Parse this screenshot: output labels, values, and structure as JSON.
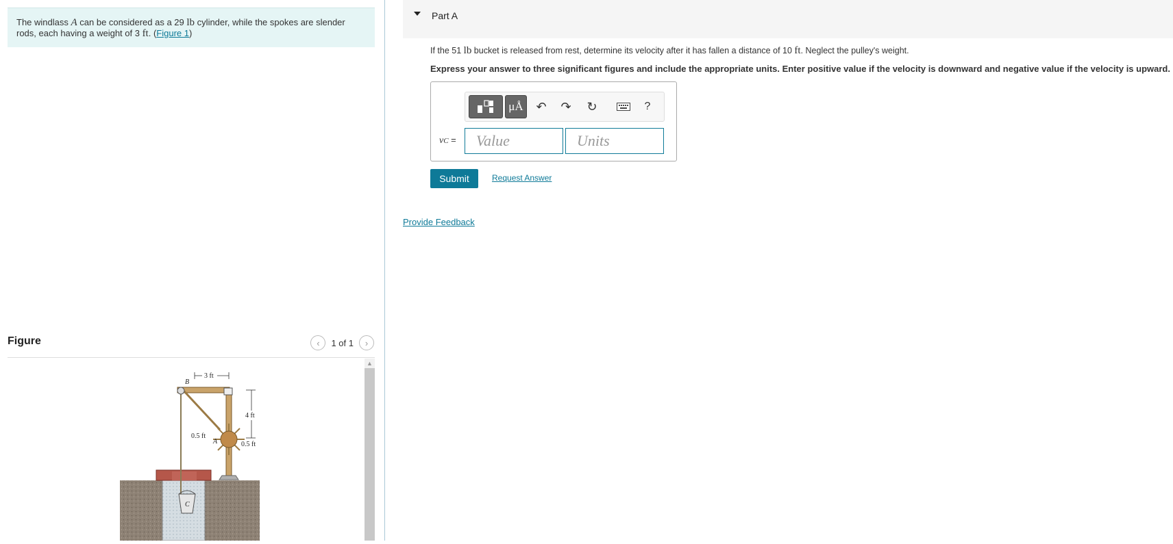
{
  "problem": {
    "text_1": "The windlass ",
    "var_a": "A",
    "text_2": " can be considered as a 29 ",
    "unit_lb": "lb",
    "text_3": " cylinder, while the spokes are slender rods, each having a weight of 3 ",
    "unit_ft": "ft",
    "text_4": ". (",
    "figure_link": "Figure 1",
    "text_5": ")"
  },
  "figure": {
    "label": "Figure",
    "pager": "1 of 1",
    "prev_icon": "chevron-left-icon",
    "next_icon": "chevron-right-icon",
    "labels": {
      "dim_3ft": "3 ft",
      "b": "B",
      "dim_4ft": "4 ft",
      "dim_05ft_left": "0.5 ft",
      "a": "A",
      "dim_05ft_right": "0.5 ft",
      "c": "C"
    }
  },
  "part": {
    "title": "Part A",
    "q_1": "If the 51 ",
    "q_unit_lb": "lb",
    "q_2": " bucket is released from rest, determine its velocity after it has fallen a distance of 10 ",
    "q_unit_ft": "ft",
    "q_3": ". Neglect the pulley's weight.",
    "instructions": "Express your answer to three significant figures and include the appropriate units. Enter positive value if the velocity is downward and negative value if the velocity is upward."
  },
  "answer": {
    "var": "v",
    "var_sub": "C",
    "equals": " =",
    "value_placeholder": "Value",
    "units_placeholder": "Units",
    "toolbar": {
      "templates_icon": "templates-icon",
      "units_symbol": "μÅ",
      "undo_icon": "undo-icon",
      "redo_icon": "redo-icon",
      "reset_icon": "reset-icon",
      "keyboard_icon": "keyboard-icon",
      "help": "?"
    }
  },
  "actions": {
    "submit": "Submit",
    "request": "Request Answer",
    "feedback": "Provide Feedback"
  },
  "colors": {
    "accent": "#0e7a98",
    "problem_bg": "#e5f5f5",
    "part_header_bg": "#f5f5f5"
  }
}
